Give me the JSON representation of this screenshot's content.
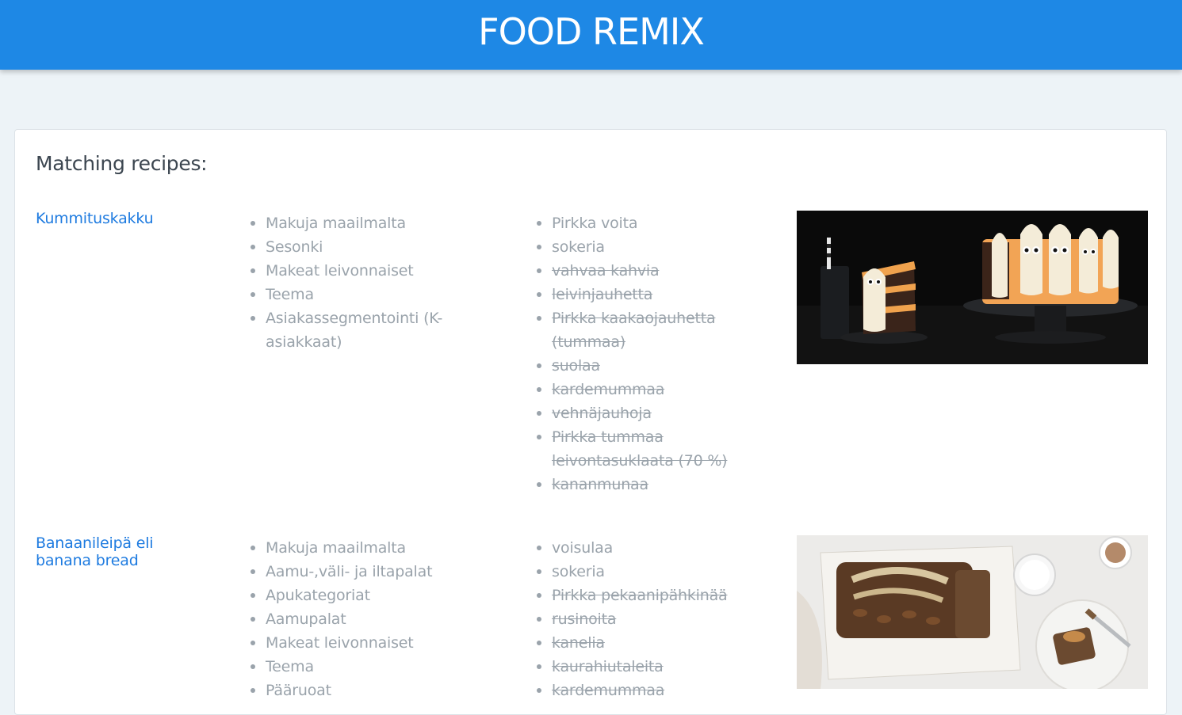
{
  "app": {
    "title": "FOOD REMIX"
  },
  "results": {
    "heading": "Matching recipes:",
    "recipes": [
      {
        "name": "Kummituskakku",
        "categories": [
          "Makuja maailmalta",
          "Sesonki",
          "Makeat leivonnaiset",
          "Teema",
          "Asiakassegmentointi (K-asiakkaat)"
        ],
        "ingredients": [
          {
            "name": "Pirkka voita",
            "have": true
          },
          {
            "name": "sokeria",
            "have": true
          },
          {
            "name": "vahvaa kahvia",
            "have": false
          },
          {
            "name": "leivinjauhetta",
            "have": false
          },
          {
            "name": "Pirkka kaakaojauhetta (tummaa)",
            "have": false
          },
          {
            "name": "suolaa",
            "have": false
          },
          {
            "name": "kardemummaa",
            "have": false
          },
          {
            "name": "vehnäjauhoja",
            "have": false
          },
          {
            "name": "Pirkka tummaa leivontasuklaata (70 %)",
            "have": false
          },
          {
            "name": "kananmunaa",
            "have": false
          }
        ],
        "image_icon": "ghost-cake-photo"
      },
      {
        "name": "Banaanileipä eli banana bread",
        "categories": [
          "Makuja maailmalta",
          "Aamu-,väli- ja iltapalat",
          "Apukategoriat",
          "Aamupalat",
          "Makeat leivonnaiset",
          "Teema",
          "Pääruoat"
        ],
        "ingredients": [
          {
            "name": "voisulaa",
            "have": true
          },
          {
            "name": "sokeria",
            "have": true
          },
          {
            "name": "Pirkka pekaanipähkinää",
            "have": false
          },
          {
            "name": "rusinoita",
            "have": false
          },
          {
            "name": "kanelia",
            "have": false
          },
          {
            "name": "kaurahiutaleita",
            "have": false
          },
          {
            "name": "kardemummaa",
            "have": false
          }
        ],
        "image_icon": "banana-bread-photo"
      }
    ]
  },
  "colors": {
    "header": "#1e88e5",
    "link": "#1e7be0",
    "muted_text": "#9aa3ab",
    "background": "#edf3f7"
  }
}
